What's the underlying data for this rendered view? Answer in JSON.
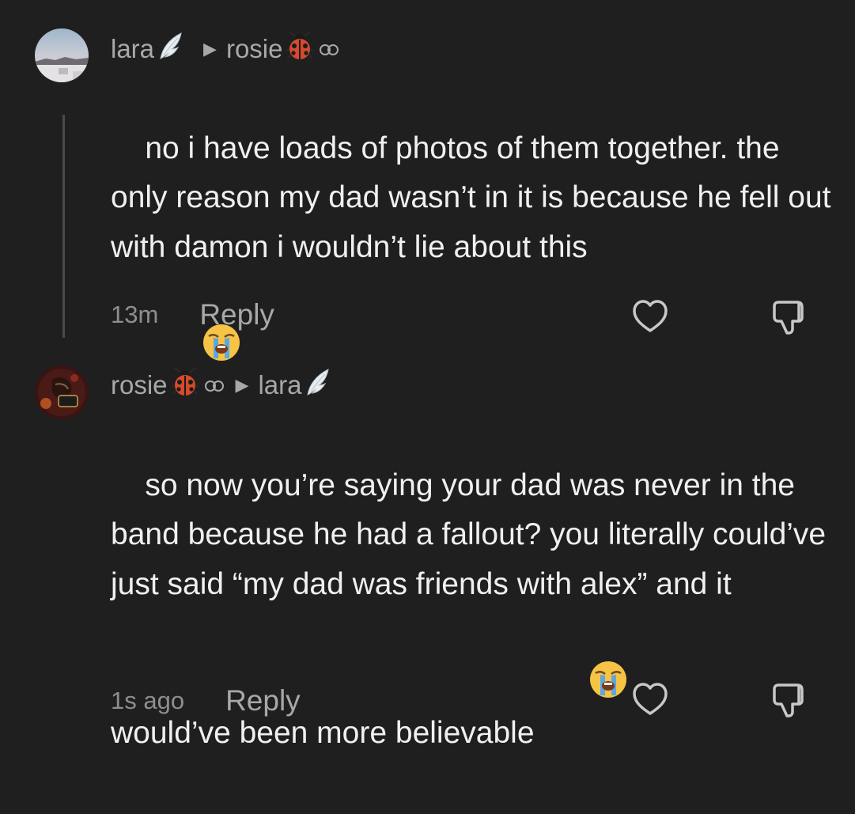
{
  "comments": [
    {
      "author": "lara",
      "reply_to": "rosie",
      "text": "no i have loads of photos of them together. the only reason my dad wasn’t in it is because he fell out with damon i wouldn’t lie about this",
      "time": "13m",
      "reply_label": "Reply",
      "author_emoji": "angel-wing-icon",
      "reply_to_emoji": "ladybug-icon"
    },
    {
      "author": "rosie",
      "reply_to": "lara",
      "text": "so now you’re saying your dad was never in the band because he had a fallout? you literally could’ve just said “my dad was friends with alex” and it would’ve been more believable",
      "time": "1s ago",
      "reply_label": "Reply",
      "author_emoji": "ladybug-icon",
      "reply_to_emoji": "angel-wing-icon"
    }
  ],
  "colors": {
    "background": "#1f1f1f",
    "text": "#f0f0f0",
    "secondary": "#a8a8a8",
    "thread_line": "#4a4a4a"
  }
}
